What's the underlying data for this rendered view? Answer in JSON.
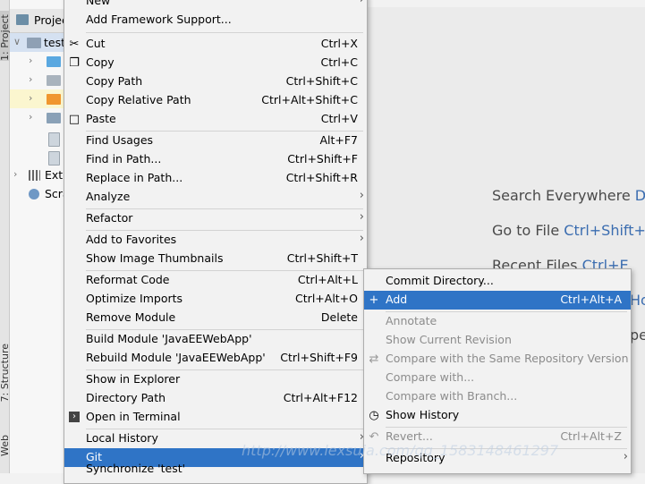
{
  "tool_strip": {
    "project": "1: Project",
    "structure": "7: Structure",
    "web": "Web"
  },
  "project_panel": {
    "header": "Project",
    "rows": [
      {
        "label": "test"
      },
      {
        "label": ""
      },
      {
        "label": ""
      },
      {
        "label": ""
      },
      {
        "label": ""
      },
      {
        "label": ""
      },
      {
        "label": ""
      },
      {
        "label": "External Libraries"
      },
      {
        "label": "Scratches and Consoles"
      }
    ]
  },
  "editor_hints": [
    {
      "label": "Search Everywhere",
      "shortcut": "Do"
    },
    {
      "label": "Go to File",
      "shortcut": "Ctrl+Shift+N"
    },
    {
      "label": "Recent Files",
      "shortcut": "Ctrl+E"
    },
    {
      "label": "",
      "shortcut": "Ho"
    },
    {
      "label": "",
      "shortcut": "pe"
    }
  ],
  "context_menu": {
    "items": [
      {
        "label": "New",
        "shortcut": "",
        "submenu": true
      },
      {
        "label": "Add Framework Support...",
        "shortcut": ""
      },
      {
        "label": "Cut",
        "shortcut": "Ctrl+X",
        "icon": "scissors-icon"
      },
      {
        "label": "Copy",
        "shortcut": "Ctrl+C",
        "icon": "copy-icon"
      },
      {
        "label": "Copy Path",
        "shortcut": "Ctrl+Shift+C"
      },
      {
        "label": "Copy Relative Path",
        "shortcut": "Ctrl+Alt+Shift+C"
      },
      {
        "label": "Paste",
        "shortcut": "Ctrl+V",
        "icon": "paste-icon"
      },
      {
        "label": "Find Usages",
        "shortcut": "Alt+F7"
      },
      {
        "label": "Find in Path...",
        "shortcut": "Ctrl+Shift+F"
      },
      {
        "label": "Replace in Path...",
        "shortcut": "Ctrl+Shift+R"
      },
      {
        "label": "Analyze",
        "shortcut": "",
        "submenu": true
      },
      {
        "label": "Refactor",
        "shortcut": "",
        "submenu": true
      },
      {
        "label": "Add to Favorites",
        "shortcut": "",
        "submenu": true
      },
      {
        "label": "Show Image Thumbnails",
        "shortcut": "Ctrl+Shift+T"
      },
      {
        "label": "Reformat Code",
        "shortcut": "Ctrl+Alt+L"
      },
      {
        "label": "Optimize Imports",
        "shortcut": "Ctrl+Alt+O"
      },
      {
        "label": "Remove Module",
        "shortcut": "Delete"
      },
      {
        "label": "Build Module 'JavaEEWebApp'",
        "shortcut": ""
      },
      {
        "label": "Rebuild Module 'JavaEEWebApp'",
        "shortcut": "Ctrl+Shift+F9"
      },
      {
        "label": "Show in Explorer",
        "shortcut": ""
      },
      {
        "label": "Directory Path",
        "shortcut": "Ctrl+Alt+F12"
      },
      {
        "label": "Open in Terminal",
        "shortcut": "",
        "icon": "terminal-icon"
      },
      {
        "label": "Local History",
        "shortcut": "",
        "submenu": true
      },
      {
        "label": "Git",
        "shortcut": "",
        "submenu": true,
        "active": true
      }
    ],
    "cutoff_item": "Synchronize 'test'"
  },
  "git_submenu": {
    "items": [
      {
        "label": "Commit Directory...",
        "shortcut": ""
      },
      {
        "label": "Add",
        "shortcut": "Ctrl+Alt+A",
        "active": true,
        "icon": "plus-icon"
      },
      {
        "label": "Annotate",
        "shortcut": "",
        "disabled": true
      },
      {
        "label": "Show Current Revision",
        "shortcut": "",
        "disabled": true
      },
      {
        "label": "Compare with the Same Repository Version",
        "shortcut": "",
        "disabled": true,
        "icon": "compare-icon"
      },
      {
        "label": "Compare with...",
        "shortcut": "",
        "disabled": true
      },
      {
        "label": "Compare with Branch...",
        "shortcut": "",
        "disabled": true
      },
      {
        "label": "Show History",
        "shortcut": "",
        "icon": "clock-icon"
      },
      {
        "label": "Revert...",
        "shortcut": "Ctrl+Alt+Z",
        "disabled": true,
        "icon": "revert-icon"
      },
      {
        "label": "Repository",
        "shortcut": "",
        "submenu": true
      }
    ]
  },
  "watermark": "http://www.lexsuia.com/qq_1583148461297"
}
